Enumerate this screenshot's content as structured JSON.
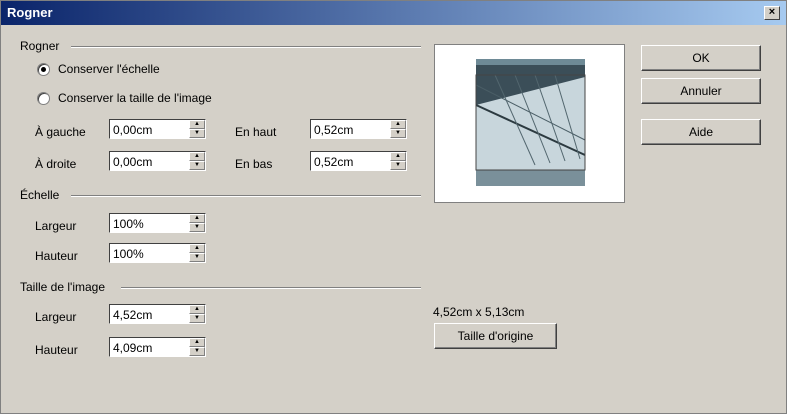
{
  "title": "Rogner",
  "close_label": "×",
  "crop": {
    "group_label": "Rogner",
    "keep_scale": "Conserver l'échelle",
    "keep_size": "Conserver la taille de l'image",
    "left_label": "À gauche",
    "left_value": "0,00cm",
    "right_label": "À droite",
    "right_value": "0,00cm",
    "top_label": "En haut",
    "top_value": "0,52cm",
    "bottom_label": "En bas",
    "bottom_value": "0,52cm"
  },
  "scale": {
    "group_label": "Échelle",
    "width_label": "Largeur",
    "width_value": "100%",
    "height_label": "Hauteur",
    "height_value": "100%"
  },
  "size": {
    "group_label": "Taille de l'image",
    "width_label": "Largeur",
    "width_value": "4,52cm",
    "height_label": "Hauteur",
    "height_value": "4,09cm",
    "original_dims": "4,52cm x 5,13cm",
    "original_button": "Taille d'origine"
  },
  "buttons": {
    "ok": "OK",
    "cancel": "Annuler",
    "help": "Aide"
  },
  "icons": [
    "close-icon",
    "radio-icon",
    "spin-up-icon",
    "spin-down-icon"
  ]
}
